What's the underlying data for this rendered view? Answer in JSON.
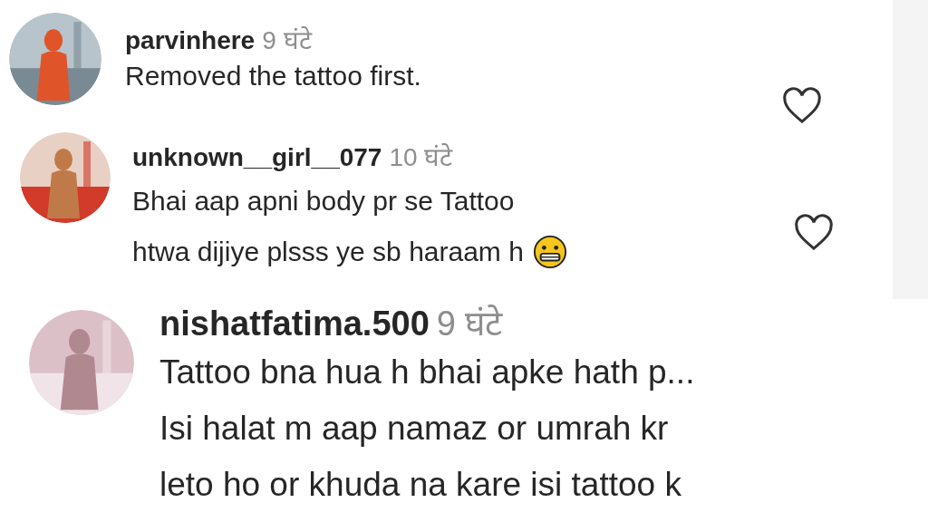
{
  "comments": [
    {
      "avatar": {
        "kind": "picture"
      },
      "username": "parvinhere",
      "time": "9 घंटे",
      "lines": [
        "Removed the tattoo first."
      ],
      "liked": false
    },
    {
      "avatar": {
        "kind": "picture"
      },
      "username": "unknown__girl__077",
      "time": "10 घंटे",
      "lines": [
        "Bhai aap apni body pr se Tattoo",
        "htwa dijiye plsss ye sb haraam h"
      ],
      "emoji": true,
      "liked": false
    },
    {
      "avatar": {
        "kind": "picture"
      },
      "username": "nishatfatima.500",
      "time": "9 घंटे",
      "lines": [
        "Tattoo bna hua h bhai apke hath p...",
        "Isi halat m aap namaz or umrah kr",
        "leto ho or khuda na kare isi tattoo k"
      ]
    }
  ]
}
